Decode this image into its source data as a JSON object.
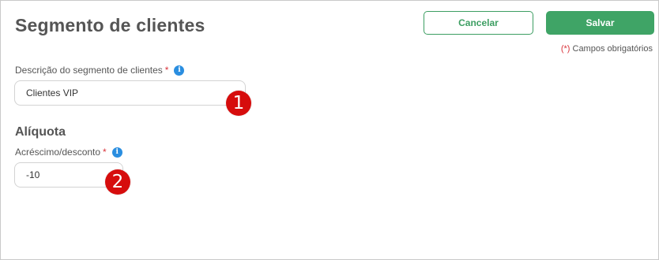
{
  "header": {
    "title": "Segmento de clientes",
    "cancel_label": "Cancelar",
    "save_label": "Salvar",
    "required_mark": "(*)",
    "required_note": " Campos obrigatórios"
  },
  "form": {
    "description": {
      "label": "Descrição do segmento de clientes",
      "required": "*",
      "value": "Clientes VIP"
    },
    "section_title": "Alíquota",
    "adjustment": {
      "label": "Acréscimo/desconto",
      "required": "*",
      "value": "-10"
    }
  },
  "annotations": {
    "badge1": "1",
    "badge2": "2"
  },
  "colors": {
    "accent_green": "#3fa466",
    "required_red": "#d9343b",
    "info_blue": "#2a8ee0",
    "badge_red": "#d60d0d"
  },
  "icons": {
    "info": "info-icon"
  }
}
